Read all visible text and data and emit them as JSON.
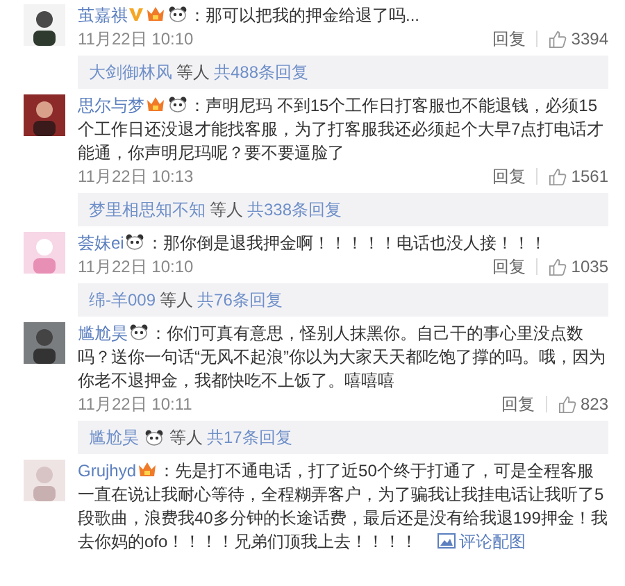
{
  "comments": [
    {
      "user": "茧嘉祺",
      "badges": [
        {
          "kind": "verified"
        },
        {
          "kind": "vip"
        },
        {
          "kind": "panda"
        }
      ],
      "text": "：那可以把我的押金给退了吗...",
      "time": "11月22日 10:10",
      "reply_label": "回复",
      "likes": "3394",
      "avatar": {
        "kind": "picture"
      },
      "thread": {
        "who": "大剑御林风",
        "others": "等人",
        "total": "共488条回复"
      }
    },
    {
      "user": "思尔与梦",
      "badges": [
        {
          "kind": "vip"
        },
        {
          "kind": "panda"
        }
      ],
      "text": "：声明尼玛 不到15个工作日打客服也不能退钱，必须15个工作日还没退才能找客服，为了打客服我还必须起个大早7点打电话才能通，你声明尼玛呢？要不要逼脸了",
      "time": "11月22日 10:13",
      "reply_label": "回复",
      "likes": "1561",
      "avatar": {
        "kind": "picture"
      },
      "thread": {
        "who": "梦里相思知不知",
        "others": "等人",
        "total": "共338条回复"
      }
    },
    {
      "user": "荟妹ei",
      "badges": [
        {
          "kind": "panda"
        }
      ],
      "text": "：那你倒是退我押金啊！！！！！电话也没人接！！！",
      "time": "11月22日 10:10",
      "reply_label": "回复",
      "likes": "1035",
      "avatar": {
        "kind": "picture"
      },
      "thread": {
        "who": "绵-羊009",
        "others": "等人",
        "total": "共76条回复"
      }
    },
    {
      "user": "尴尬昊",
      "badges": [
        {
          "kind": "panda"
        }
      ],
      "text": "：你们可真有意思，怪别人抹黑你。自己干的事心里没点数吗？送你一句话“无风不起浪”你以为大家天天都吃饱了撑的吗。哦，因为你老不退押金，我都快吃不上饭了。嘻嘻嘻",
      "time": "11月22日 10:11",
      "reply_label": "回复",
      "likes": "823",
      "avatar": {
        "kind": "picture"
      },
      "thread": {
        "who": "尴尬昊",
        "who_badges": [
          {
            "kind": "panda"
          }
        ],
        "others": "等人",
        "total": "共17条回复"
      }
    },
    {
      "user": "Grujhyd",
      "badges": [
        {
          "kind": "vip"
        }
      ],
      "text": "：先是打不通电话，打了近50个终于打通了，可是全程客服一直在说让我耐心等待，全程糊弄客户，为了骗我让我挂电话让我听了5段歌曲，浪费我40多分钟的长途话费，最后还是没有给我退199押金！我去你妈的ofo！！！！兄弟们顶我上去！！！！",
      "image_link": "评论配图",
      "avatar": {
        "kind": "picture"
      }
    }
  ]
}
